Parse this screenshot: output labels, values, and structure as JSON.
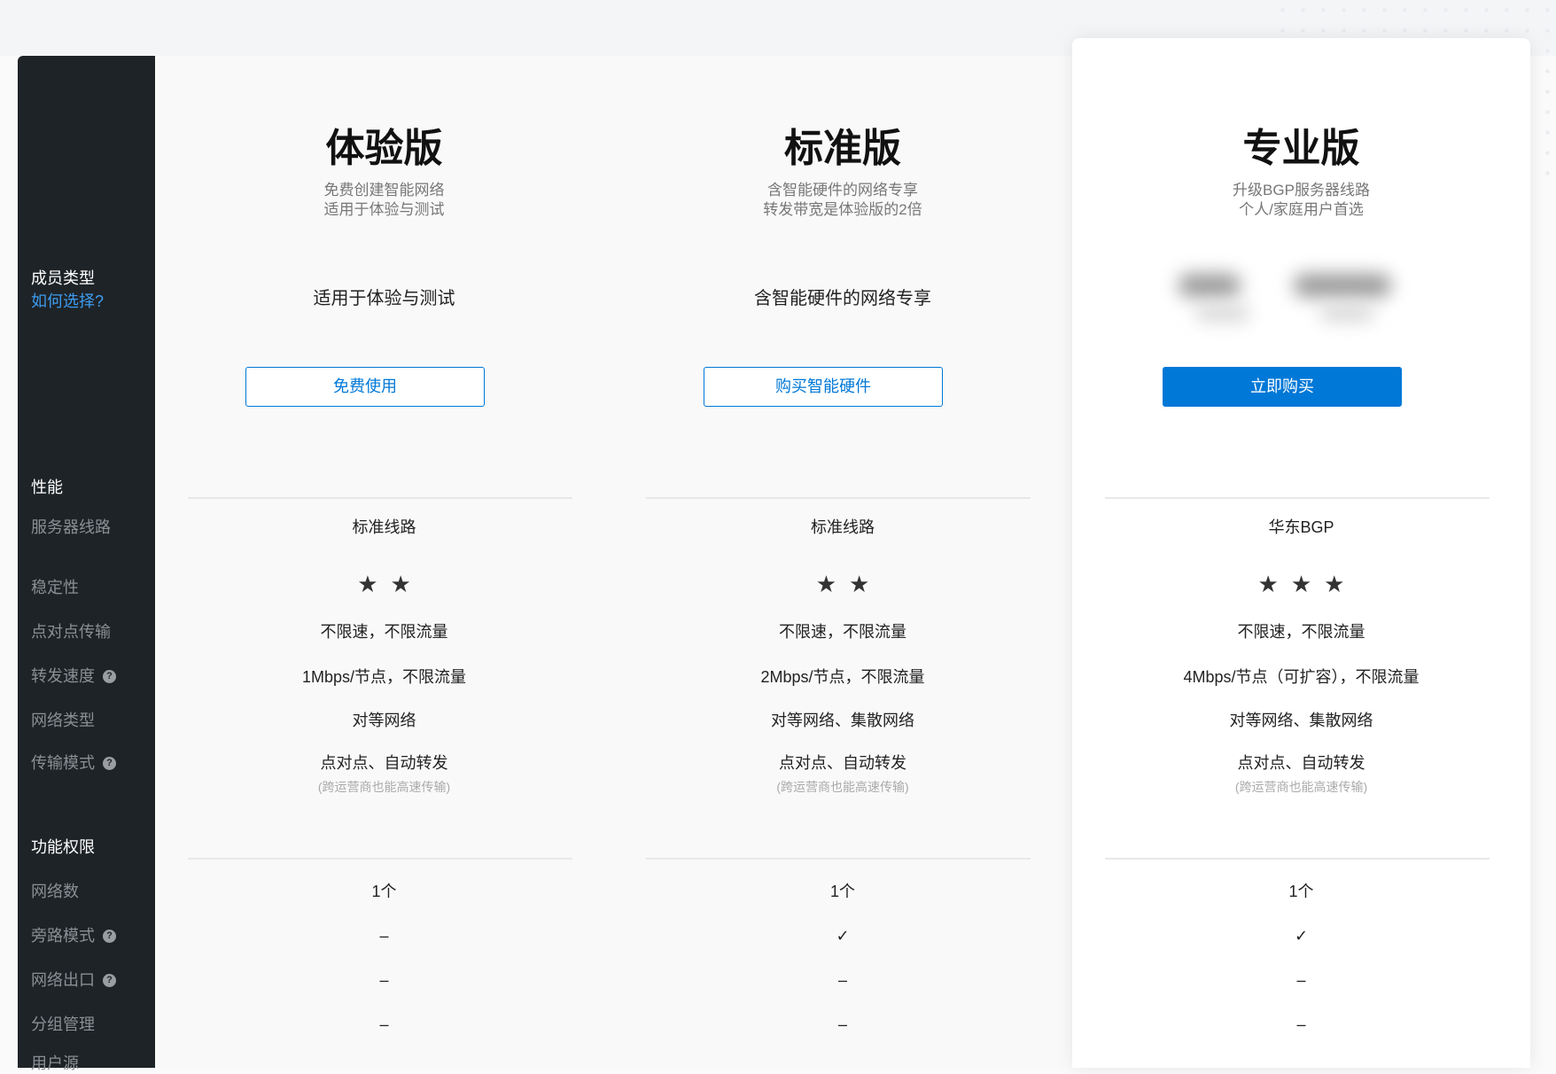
{
  "sidebar": {
    "member_type": "成员类型",
    "how_to_choose": "如何选择?",
    "performance": "性能",
    "perf_items": [
      "服务器线路",
      "稳定性",
      "点对点传输",
      "转发速度",
      "网络类型",
      "传输模式"
    ],
    "features": "功能权限",
    "feature_items": [
      "网络数",
      "旁路模式",
      "网络出口",
      "分组管理",
      "用户源"
    ],
    "help_icon": "?"
  },
  "plans": [
    {
      "title": "体验版",
      "sub1": "免费创建智能网络",
      "sub2": "适用于体验与测试",
      "tagline": "适用于体验与测试",
      "button": "免费使用",
      "line": "标准线路",
      "stars": 2,
      "stars_text": "★★",
      "p2p": "不限速，不限流量",
      "speed": "1Mbps/节点，不限流量",
      "net_type": "对等网络",
      "mode": "点对点、自动转发",
      "mode_note": "(跨运营商也能高速传输)",
      "f": [
        "1个",
        "–",
        "–",
        "–"
      ]
    },
    {
      "title": "标准版",
      "sub1": "含智能硬件的网络专享",
      "sub2": "转发带宽是体验版的2倍",
      "tagline": "含智能硬件的网络专享",
      "button": "购买智能硬件",
      "line": "标准线路",
      "stars": 2,
      "stars_text": "★★",
      "p2p": "不限速，不限流量",
      "speed": "2Mbps/节点，不限流量",
      "net_type": "对等网络、集散网络",
      "mode": "点对点、自动转发",
      "mode_note": "(跨运营商也能高速传输)",
      "f": [
        "1个",
        "✓",
        "–",
        "–"
      ]
    },
    {
      "title": "专业版",
      "sub1": "升级BGP服务器线路",
      "sub2": "个人/家庭用户首选",
      "tagline": "",
      "button": "立即购买",
      "line": "华东BGP",
      "stars": 3,
      "stars_text": "★★★",
      "p2p": "不限速，不限流量",
      "speed": "4Mbps/节点（可扩容），不限流量",
      "net_type": "对等网络、集散网络",
      "mode": "点对点、自动转发",
      "mode_note": "(跨运营商也能高速传输)",
      "f": [
        "1个",
        "✓",
        "–",
        "–"
      ]
    }
  ],
  "colors": {
    "sidebar": "#1e2327",
    "accent": "#0078d7",
    "link": "#3d9cf0"
  }
}
